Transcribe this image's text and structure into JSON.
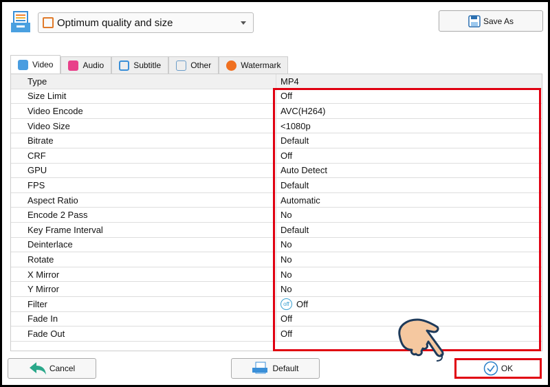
{
  "preset": {
    "label": "Optimum quality and size"
  },
  "toolbar": {
    "save_as": "Save As"
  },
  "tabs": [
    {
      "label": "Video"
    },
    {
      "label": "Audio"
    },
    {
      "label": "Subtitle"
    },
    {
      "label": "Other"
    },
    {
      "label": "Watermark"
    }
  ],
  "table": {
    "header": {
      "key": "Type",
      "value": "MP4"
    },
    "rows": [
      {
        "key": "Size Limit",
        "value": "Off"
      },
      {
        "key": "Video Encode",
        "value": "AVC(H264)"
      },
      {
        "key": "Video Size",
        "value": "<1080p"
      },
      {
        "key": "Bitrate",
        "value": "Default"
      },
      {
        "key": "CRF",
        "value": "Off"
      },
      {
        "key": "GPU",
        "value": "Auto Detect"
      },
      {
        "key": "FPS",
        "value": "Default"
      },
      {
        "key": "Aspect Ratio",
        "value": "Automatic"
      },
      {
        "key": "Encode 2 Pass",
        "value": "No"
      },
      {
        "key": "Key Frame Interval",
        "value": "Default"
      },
      {
        "key": "Deinterlace",
        "value": "No"
      },
      {
        "key": "Rotate",
        "value": "No"
      },
      {
        "key": "X Mirror",
        "value": "No"
      },
      {
        "key": "Y Mirror",
        "value": "No"
      },
      {
        "key": "Filter",
        "value": "Off",
        "icon": "off"
      },
      {
        "key": "Fade In",
        "value": "Off"
      },
      {
        "key": "Fade Out",
        "value": "Off"
      }
    ]
  },
  "footer": {
    "cancel": "Cancel",
    "default": "Default",
    "ok": "OK"
  },
  "colors": {
    "highlight": "#e00010"
  }
}
